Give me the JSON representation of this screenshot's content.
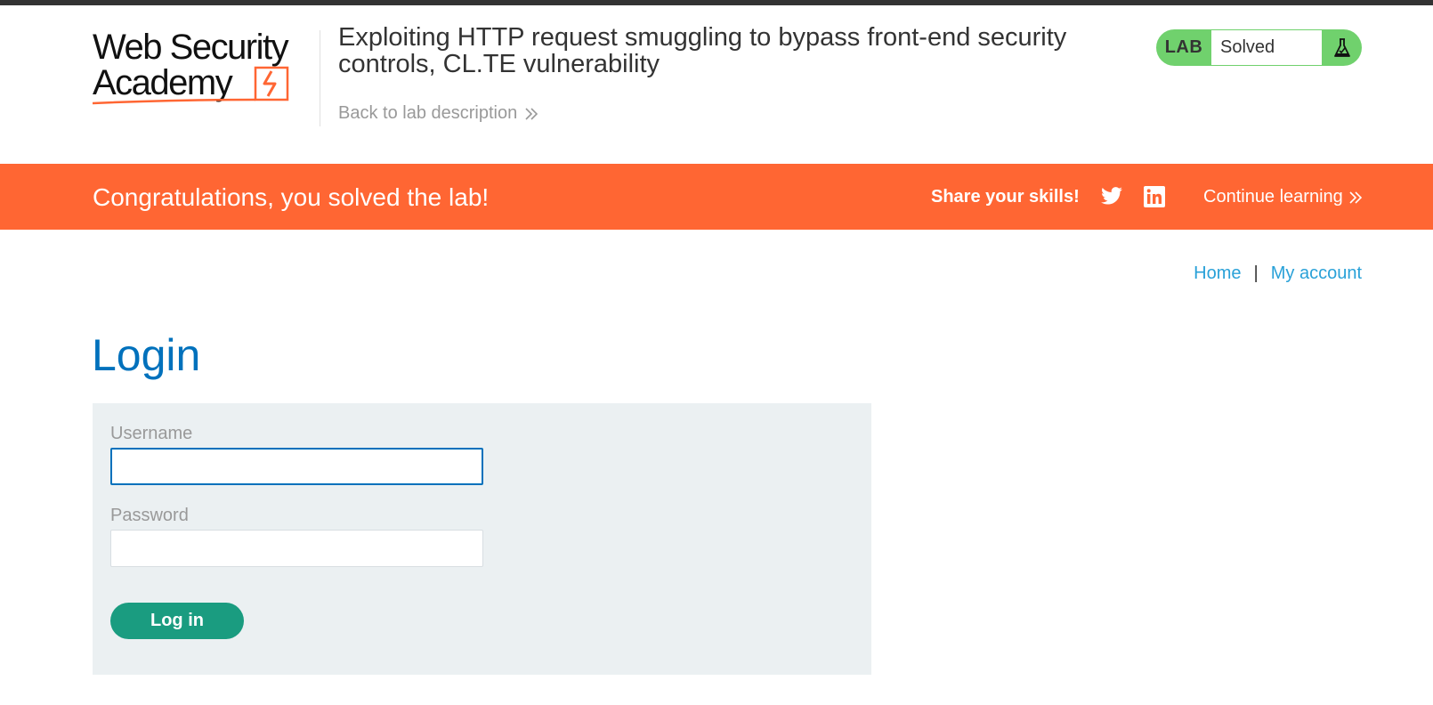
{
  "header": {
    "logo": {
      "line1": "Web Security",
      "line2": "Academy"
    },
    "lab_title": "Exploiting HTTP request smuggling to bypass front-end security controls, CL.TE vulnerability",
    "back_link": "Back to lab description",
    "lab_badge": {
      "label": "LAB",
      "status": "Solved",
      "icon": "flask-icon",
      "color": "#70d16d"
    }
  },
  "banner": {
    "message": "Congratulations, you solved the lab!",
    "share_label": "Share your skills!",
    "share_icons": [
      "twitter-icon",
      "linkedin-icon"
    ],
    "continue_link": "Continue learning",
    "color": "#ff6633"
  },
  "nav": {
    "items": [
      {
        "label": "Home"
      },
      {
        "label": "My account"
      }
    ],
    "separator": "|"
  },
  "login": {
    "title": "Login",
    "username_label": "Username",
    "username_value": "",
    "password_label": "Password",
    "password_value": "",
    "submit_label": "Log in"
  },
  "colors": {
    "title_blue": "#0071bc",
    "link_blue": "#29a1d8",
    "button_green": "#1a9c80",
    "panel_bg": "#ebf0f2"
  }
}
